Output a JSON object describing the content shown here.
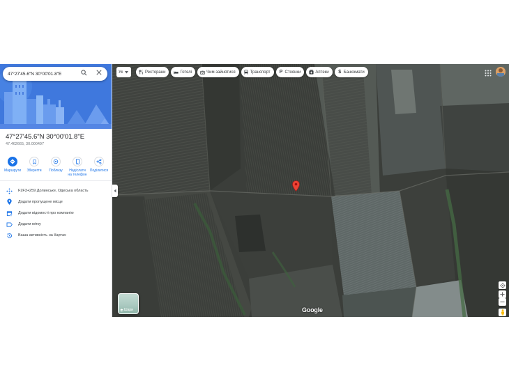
{
  "search": {
    "value": "47°27'45.6\"N 30°00'01.8\"E"
  },
  "place": {
    "title": "47°27'45.6\"N 30°00'01.8\"E",
    "subtitle": "47.462665, 30.000497"
  },
  "actions": [
    {
      "label": "Маршрути",
      "icon": "directions-icon"
    },
    {
      "label": "Зберегти",
      "icon": "bookmark-icon"
    },
    {
      "label": "Поблизу",
      "icon": "nearby-icon"
    },
    {
      "label": "Надіслати на телефон",
      "icon": "phone-icon"
    },
    {
      "label": "Поділитися",
      "icon": "share-icon"
    }
  ],
  "info_rows": [
    {
      "text": "F2F3+259 Долинське, Одеська область",
      "icon": "plus-code-icon"
    },
    {
      "text": "Додати пропущене місце",
      "icon": "add-place-icon"
    },
    {
      "text": "Додати відомості про компанію",
      "icon": "business-icon"
    },
    {
      "text": "Додати мітку",
      "icon": "label-icon"
    },
    {
      "text": "Ваша активність на Картах",
      "icon": "history-icon"
    }
  ],
  "map": {
    "language": "Ук",
    "chips": [
      {
        "label": "Ресторани",
        "icon": "fork-knife-icon"
      },
      {
        "label": "Готелі",
        "icon": "bed-icon"
      },
      {
        "label": "Чим зайнятися",
        "icon": "camera-icon"
      },
      {
        "label": "Транспорт",
        "icon": "train-icon"
      },
      {
        "label": "Стоянки",
        "icon": "parking-icon"
      },
      {
        "label": "Аптеки",
        "icon": "pharmacy-icon"
      },
      {
        "label": "Банкомати",
        "icon": "atm-icon"
      }
    ],
    "layers_label": "Шари",
    "logo": "Google",
    "pin_color": "#ea4335",
    "accent": "#1a73e8"
  }
}
